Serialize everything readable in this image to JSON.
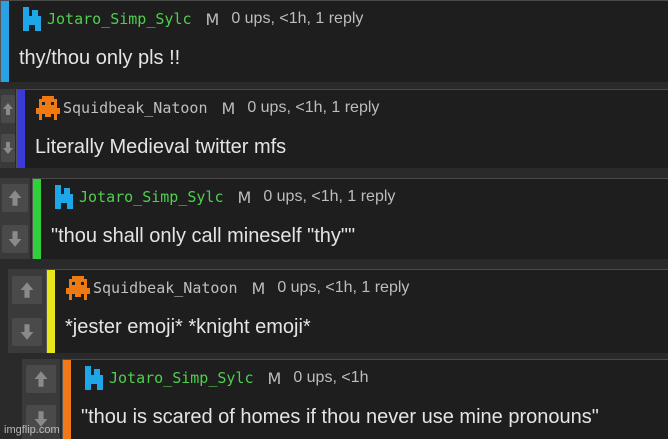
{
  "colors": {
    "card_bg": "#1e1e1e",
    "page_bg": "#2a2a2a",
    "meta_text": "#bdbdbd",
    "body_text": "#e4e4e4"
  },
  "comments": [
    {
      "username": "Jotaro_Simp_Sylc",
      "username_color": "#4fcf4f",
      "mod_badge": "M",
      "stats": "0 ups, <1h, 1 reply",
      "text": "thy/thou only pls !!",
      "depth_color": "#2aa0e6",
      "avatar": "blue-pixel-figure-icon",
      "has_vote_buttons": false
    },
    {
      "username": "Squidbeak_Natoon",
      "username_color": "#bfbfbf",
      "mod_badge": "M",
      "stats": "0 ups, <1h, 1 reply",
      "text": "Literally Medieval twitter mfs",
      "depth_color": "#3a3ad8",
      "avatar": "orange-pixel-alien-icon",
      "has_vote_buttons": true
    },
    {
      "username": "Jotaro_Simp_Sylc",
      "username_color": "#4fcf4f",
      "mod_badge": "M",
      "stats": "0 ups, <1h, 1 reply",
      "text": "\"thou shall only call mineself \"thy\"\"",
      "depth_color": "#2fd03a",
      "avatar": "blue-pixel-figure-icon",
      "has_vote_buttons": true
    },
    {
      "username": "Squidbeak_Natoon",
      "username_color": "#bfbfbf",
      "mod_badge": "M",
      "stats": "0 ups, <1h, 1 reply",
      "text": "*jester emoji* *knight emoji*",
      "depth_color": "#e6e61a",
      "avatar": "orange-pixel-alien-icon",
      "has_vote_buttons": true
    },
    {
      "username": "Jotaro_Simp_Sylc",
      "username_color": "#4fcf4f",
      "mod_badge": "M",
      "stats": "0 ups, <1h",
      "text": "\"thou is scared of homes if thou never use mine pronouns\"",
      "depth_color": "#f07818",
      "avatar": "blue-pixel-figure-icon",
      "has_vote_buttons": true
    }
  ],
  "watermark": "imgflip.com"
}
